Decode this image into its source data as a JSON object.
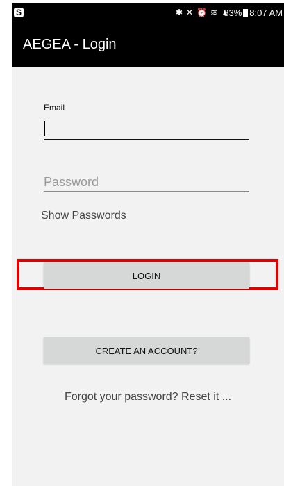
{
  "status_bar": {
    "left_icon": "skype-icon",
    "icons": [
      "bluetooth-icon",
      "mute-icon",
      "alarm-icon",
      "wifi-icon",
      "signal-icon"
    ],
    "battery": "83%",
    "time": "8:07 AM"
  },
  "app_bar": {
    "title": "AEGEA - Login"
  },
  "form": {
    "email_label": "Email",
    "email_value": "",
    "password_placeholder": "Password",
    "show_passwords_label": "Show Passwords"
  },
  "buttons": {
    "login_label": "LOGIN",
    "create_account_label": "CREATE AN ACCOUNT?"
  },
  "links": {
    "forgot_password": "Forgot your password? Reset it ..."
  },
  "colors": {
    "app_bar_bg": "#000000",
    "screen_bg": "#f2f2f2",
    "button_bg": "#d6d7d7",
    "highlight": "#e00000"
  }
}
